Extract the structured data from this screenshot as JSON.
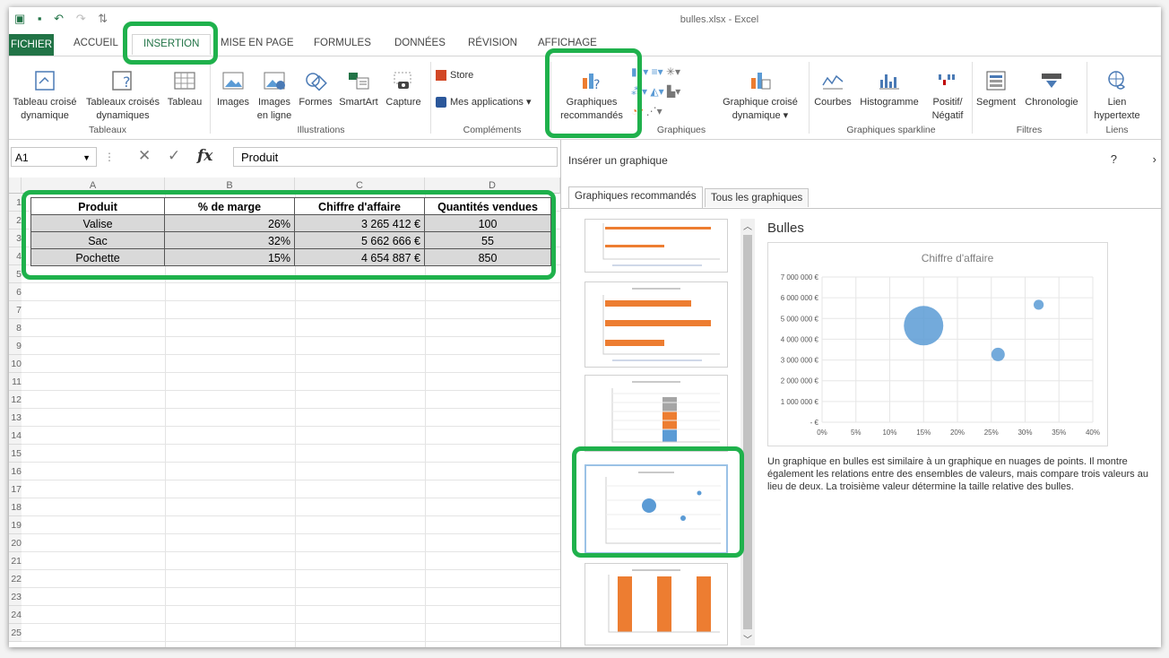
{
  "window": {
    "title": "bulles.xlsx - Excel"
  },
  "tabs": [
    "FICHIER",
    "ACCUEIL",
    "INSERTION",
    "MISE EN PAGE",
    "FORMULES",
    "DONNÉES",
    "RÉVISION",
    "AFFICHAGE"
  ],
  "ribbon": {
    "tables": {
      "pivot": "Tableau croisé dynamique",
      "recommended_pivot": "Tableaux croisés dynamiques",
      "table": "Tableau",
      "group": "Tableaux"
    },
    "illustrations": {
      "images": "Images",
      "online_images": "Images en ligne",
      "shapes": "Formes",
      "smartart": "SmartArt",
      "capture": "Capture",
      "group": "Illustrations"
    },
    "addins": {
      "store": "Store",
      "my_apps": "Mes applications",
      "group": "Compléments"
    },
    "charts": {
      "recommended": "Graphiques recommandés",
      "pivot_chart": "Graphique croisé dynamique",
      "group": "Graphiques"
    },
    "sparklines": {
      "lines": "Courbes",
      "column": "Histogramme",
      "winloss": "Positif/ Négatif",
      "group": "Graphiques sparkline"
    },
    "filters": {
      "slicer": "Segment",
      "timeline": "Chronologie",
      "group": "Filtres"
    },
    "links": {
      "hyperlink": "Lien hypertexte",
      "group": "Liens"
    }
  },
  "formula_bar": {
    "name_box": "A1",
    "fx": "fx",
    "value": "Produit"
  },
  "sheet": {
    "columns": [
      "A",
      "B",
      "C",
      "D"
    ],
    "rows": [
      "1",
      "2",
      "3",
      "4",
      "5",
      "6",
      "7",
      "8",
      "9",
      "10",
      "11",
      "12",
      "13",
      "14",
      "15",
      "16",
      "17",
      "18",
      "19",
      "20",
      "21",
      "22",
      "23",
      "24",
      "25"
    ],
    "headers": [
      "Produit",
      "% de marge",
      "Chiffre d'affaire",
      "Quantités vendues"
    ],
    "data": [
      [
        "Valise",
        "26%",
        "3 265 412 €",
        "100"
      ],
      [
        "Sac",
        "32%",
        "5 662 666 €",
        "55"
      ],
      [
        "Pochette",
        "15%",
        "4 654 887 €",
        "850"
      ]
    ]
  },
  "dialog": {
    "title": "Insérer un graphique",
    "help": "?",
    "close": "›",
    "tabs": [
      "Graphiques recommandés",
      "Tous les graphiques"
    ],
    "preview_title": "Bulles",
    "description": "Un graphique en bulles est similaire à un graphique en nuages de points. Il montre également les relations entre des ensembles de valeurs, mais compare trois valeurs au lieu de deux. La troisième valeur détermine la taille relative des bulles."
  },
  "chart_data": {
    "type": "scatter",
    "title": "Chiffre d'affaire",
    "x": [
      0.26,
      0.32,
      0.15
    ],
    "y": [
      3265412,
      5662666,
      4654887
    ],
    "size": [
      100,
      55,
      850
    ],
    "xlim": [
      0,
      0.4
    ],
    "ylim": [
      0,
      7000000
    ],
    "xticks": [
      "0%",
      "5%",
      "10%",
      "15%",
      "20%",
      "25%",
      "30%",
      "35%",
      "40%"
    ],
    "yticks": [
      "- €",
      "1 000 000 €",
      "2 000 000 €",
      "3 000 000 €",
      "4 000 000 €",
      "5 000 000 €",
      "6 000 000 €",
      "7 000 000 €"
    ],
    "color": "#5b9bd5",
    "grid": true
  },
  "colors": {
    "excel_green": "#217346",
    "highlight": "#1fb14c",
    "orange": "#ed7d31",
    "blue": "#5b9bd5",
    "grey": "#a5a5a5"
  }
}
